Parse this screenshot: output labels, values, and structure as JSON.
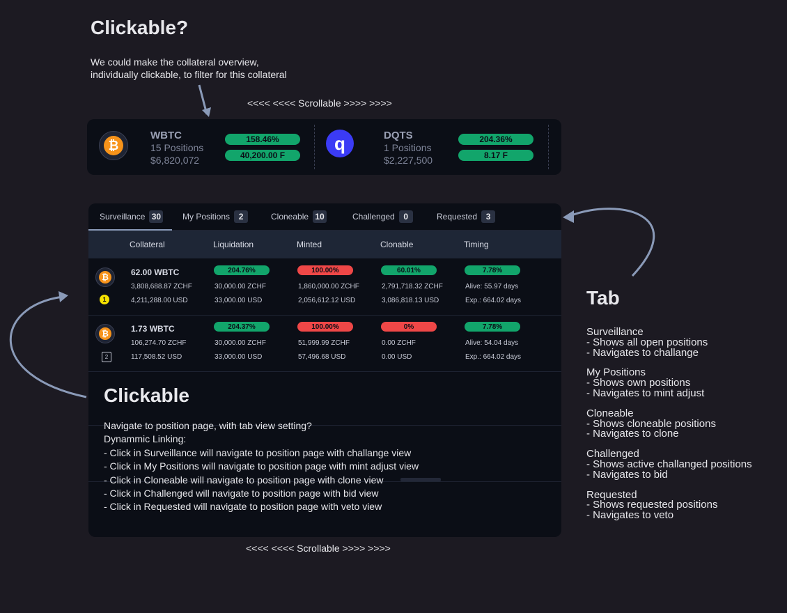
{
  "top_annotation": {
    "title": "Clickable?",
    "line1": "We could make the collateral overview,",
    "line2": "individually clickable, to filter for this collateral"
  },
  "scroll_label_top": "<<<< <<<< Scrollable >>>> >>>>",
  "scroll_label_bottom": "<<<< <<<< Scrollable >>>> >>>>",
  "collaterals": [
    {
      "symbol": "WBTC",
      "positions": "15 Positions",
      "value": "$6,820,072",
      "ratio": "158.46%",
      "limit": "40,200.00 F",
      "icon": "bitcoin-icon"
    },
    {
      "symbol": "DQTS",
      "positions": "1 Positions",
      "value": "$2,227,500",
      "ratio": "204.36%",
      "limit": "8.17 F",
      "icon": "dqts-icon"
    }
  ],
  "tabs": [
    {
      "label": "Surveillance",
      "count": "30"
    },
    {
      "label": "My Positions",
      "count": "2"
    },
    {
      "label": "Cloneable",
      "count": "10"
    },
    {
      "label": "Challenged",
      "count": "0"
    },
    {
      "label": "Requested",
      "count": "3"
    }
  ],
  "table": {
    "headers": [
      "Collateral",
      "Liquidation",
      "Minted",
      "Clonable",
      "Timing"
    ],
    "rows": [
      {
        "collateral": "62.00 WBTC",
        "collateral_zchf": "3,808,688.87 ZCHF",
        "collateral_usd": "4,211,288.00 USD",
        "badge": "1",
        "liq_pct": "204.76%",
        "liq_zchf": "30,000.00 ZCHF",
        "liq_usd": "33,000.00 USD",
        "minted_pct": "100.00%",
        "minted_zchf": "1,860,000.00 ZCHF",
        "minted_usd": "2,056,612.12 USD",
        "clonable_pct": "60.01%",
        "clonable_zchf": "2,791,718.32 ZCHF",
        "clonable_usd": "3,086,818.13 USD",
        "timing_pct": "7.78%",
        "alive": "Alive: 55.97 days",
        "exp": "Exp.: 664.02 days",
        "clonable_color": "green"
      },
      {
        "collateral": "1.73 WBTC",
        "collateral_zchf": "106,274.70 ZCHF",
        "collateral_usd": "117,508.52 USD",
        "badge": "2",
        "liq_pct": "204.37%",
        "liq_zchf": "30,000.00 ZCHF",
        "liq_usd": "33,000.00 USD",
        "minted_pct": "100.00%",
        "minted_zchf": "51,999.99 ZCHF",
        "minted_usd": "57,496.68 USD",
        "clonable_pct": "0%",
        "clonable_zchf": "0.00 ZCHF",
        "clonable_usd": "0.00 USD",
        "timing_pct": "7.78%",
        "alive": "Alive: 54.04 days",
        "exp": "Exp.: 664.02 days",
        "clonable_color": "red"
      }
    ]
  },
  "clickable_note": {
    "title": "Clickable",
    "lines": [
      "Navigate to position page, with tab view setting?",
      "Dynammic Linking:",
      "- Click in Surveillance will navigate to position page with challange view",
      "- Click in My Positions will navigate to position page with mint adjust view",
      "- Click in Cloneable will navigate to position page with clone view",
      "- Click in Challenged will navigate to position page with bid view",
      "- Click in Requested will navigate to position page with veto view"
    ]
  },
  "tab_note": {
    "title": "Tab",
    "groups": [
      {
        "name": "Surveillance",
        "lines": [
          "- Shows all open positions",
          "- Navigates to challange"
        ]
      },
      {
        "name": "My Positions",
        "lines": [
          "- Shows own positions",
          "- Navigates to mint adjust"
        ]
      },
      {
        "name": "Cloneable",
        "lines": [
          "- Shows cloneable positions",
          "- Navigates to clone"
        ]
      },
      {
        "name": "Challenged",
        "lines": [
          "- Shows active challanged positions",
          "- Navigates to bid"
        ]
      },
      {
        "name": "Requested",
        "lines": [
          "- Shows requested positions",
          "- Navigates to veto"
        ]
      }
    ]
  },
  "colors": {
    "green": "#12a56b",
    "red": "#ef4747",
    "background": "#1c1a22",
    "card": "#0b0e16"
  }
}
